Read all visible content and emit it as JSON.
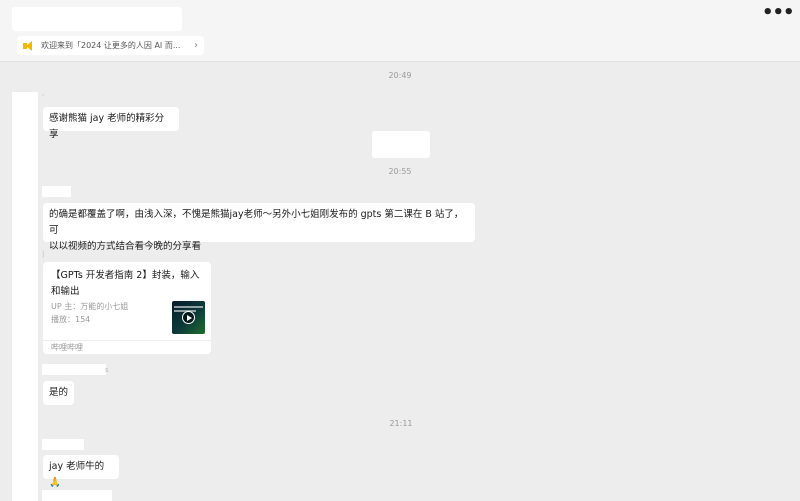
{
  "header": {
    "more_label": "•••",
    "announcement": {
      "text": "欢迎来到「2024 让更多的人因 AI 而...",
      "icon": "speaker-icon",
      "chevron": "›"
    }
  },
  "timestamps": [
    "20:49",
    "20:55",
    "21:11"
  ],
  "messages": {
    "m1": {
      "text": "感谢熊猫 jay 老师的精彩分享"
    },
    "m2": {
      "line1": "的确是都覆盖了啊，由浅入深，不愧是熊猫jay老师～另外小七姐刚发布的 gpts 第二课在 B 站了，可",
      "line2": "以以视频的方式结合看今晚的分享看"
    },
    "link_card": {
      "title_line1": "【GPTs 开发者指南 2】封装，输入",
      "title_line2": "和输出",
      "uploader": "UP 主：万能的小七姐",
      "plays": "播放：154",
      "source": "哔哩哔哩",
      "thumbnail": "video-thumbnail"
    },
    "m3": {
      "text": "是的"
    },
    "m4": {
      "text": "jay 老师牛的🙏"
    }
  }
}
